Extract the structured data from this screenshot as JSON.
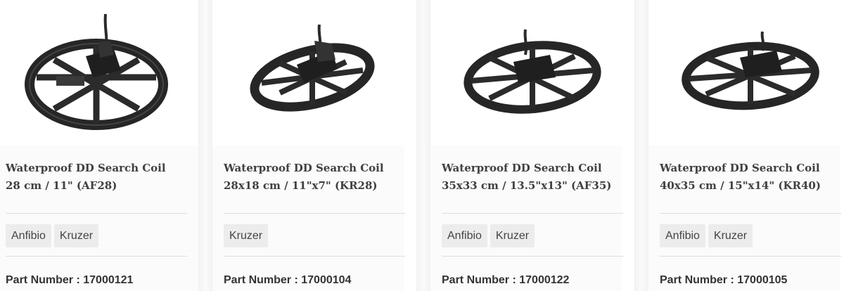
{
  "products": [
    {
      "title_line1": "Waterproof DD Search Coil",
      "title_line2": "28 cm / 11\" (AF28)",
      "tags": [
        "Anfibio",
        "Kruzer"
      ],
      "part_label": "Part Number : 17000121"
    },
    {
      "title_line1": "Waterproof DD Search Coil",
      "title_line2": "28x18 cm / 11\"x7\" (KR28)",
      "tags": [
        "Kruzer"
      ],
      "part_label": "Part Number : 17000104"
    },
    {
      "title_line1": "Waterproof DD Search Coil",
      "title_line2": "35x33 cm / 13.5\"x13\" (AF35)",
      "tags": [
        "Anfibio",
        "Kruzer"
      ],
      "part_label": "Part Number : 17000122"
    },
    {
      "title_line1": "Waterproof DD Search Coil",
      "title_line2": "40x35 cm / 15\"x14\" (KR40)",
      "tags": [
        "Anfibio",
        "Kruzer"
      ],
      "part_label": "Part Number : 17000105"
    }
  ],
  "colors": {
    "coil": "#2a2a2a",
    "tag_bg": "#ececec",
    "title_text": "#404040"
  }
}
